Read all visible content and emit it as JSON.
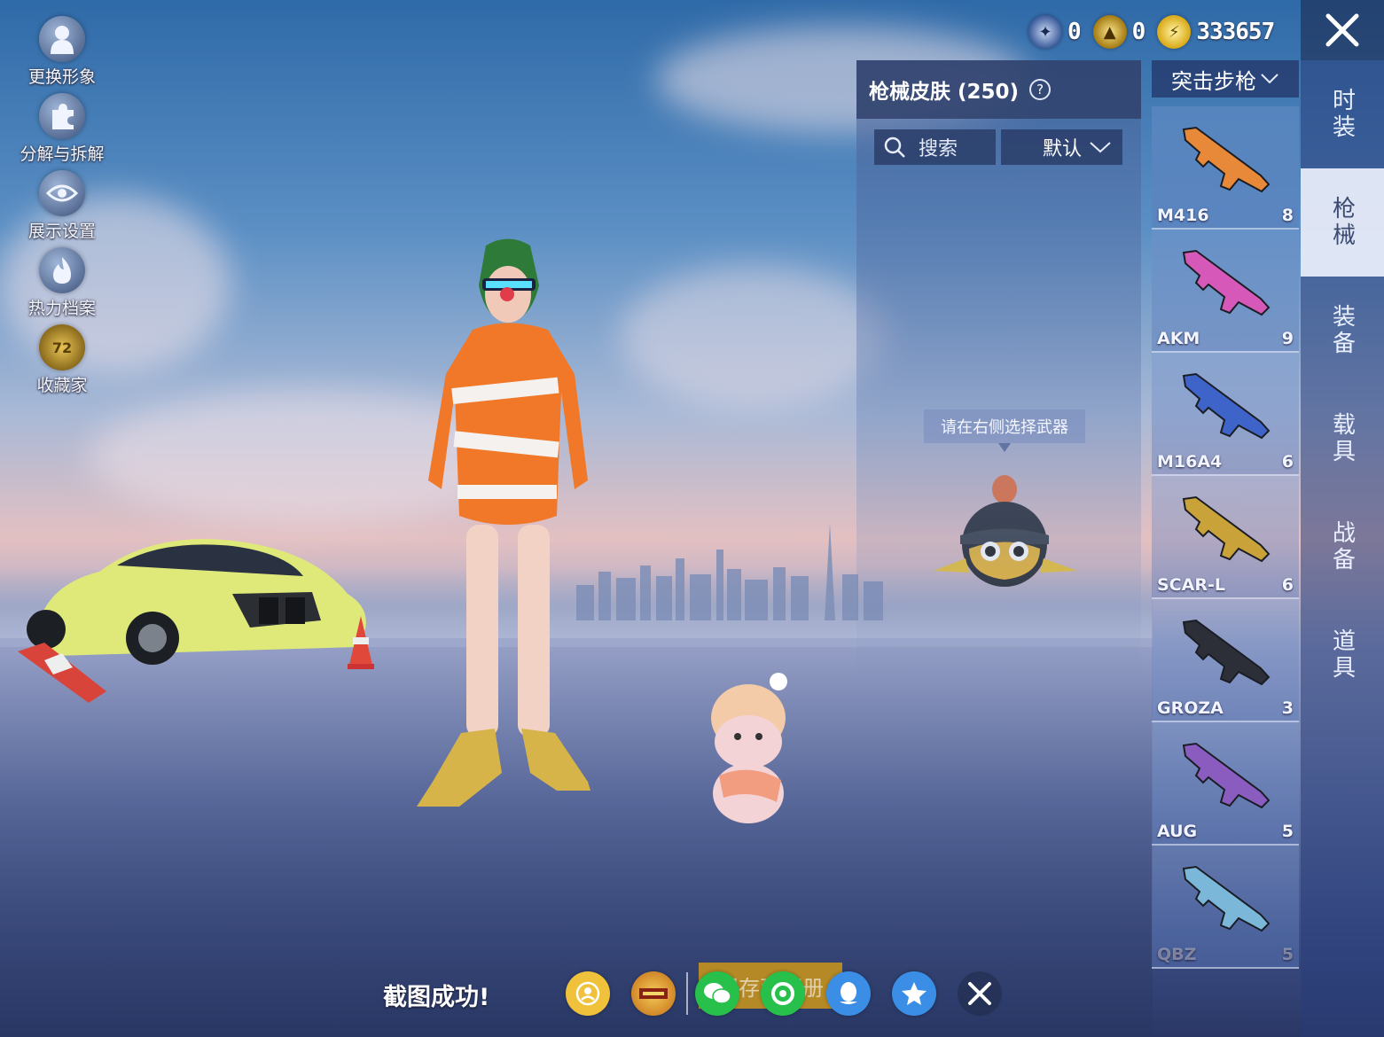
{
  "left_menu": [
    {
      "label": "更换形象",
      "icon": "person-icon"
    },
    {
      "label": "分解与拆解",
      "icon": "puzzle-icon"
    },
    {
      "label": "展示设置",
      "icon": "eye-icon"
    },
    {
      "label": "热力档案",
      "icon": "flame-icon"
    },
    {
      "label": "收藏家",
      "icon": "collector-badge-icon",
      "badge": "72"
    }
  ],
  "currency": [
    {
      "icon": "blue-coin-icon",
      "value": "0"
    },
    {
      "icon": "gold-coin-icon",
      "value": "0"
    },
    {
      "icon": "lightning-coin-icon",
      "value": "333657"
    }
  ],
  "skin_panel": {
    "title": "枪械皮肤 (250)",
    "help": "?",
    "search_placeholder": "搜索",
    "sort_label": "默认",
    "hint": "请在右侧选择武器"
  },
  "weapon_filter": {
    "label": "突击步枪"
  },
  "weapons": [
    {
      "name": "M416",
      "count": "8",
      "color": "#e8893a"
    },
    {
      "name": "AKM",
      "count": "9",
      "color": "#d659b9"
    },
    {
      "name": "M16A4",
      "count": "6",
      "color": "#3e63c9"
    },
    {
      "name": "SCAR-L",
      "count": "6",
      "color": "#c9a33a"
    },
    {
      "name": "GROZA",
      "count": "3",
      "color": "#2c2f38"
    },
    {
      "name": "AUG",
      "count": "5",
      "color": "#8a5cc0"
    },
    {
      "name": "QBZ",
      "count": "5",
      "color": "#7bb7d8"
    }
  ],
  "tabs": [
    {
      "label": "时装",
      "active": false
    },
    {
      "label": "枪械",
      "active": true
    },
    {
      "label": "装备",
      "active": false
    },
    {
      "label": "载具",
      "active": false
    },
    {
      "label": "战备",
      "active": false
    },
    {
      "label": "道具",
      "active": false
    }
  ],
  "bottom": {
    "screenshot_msg": "截图成功!",
    "save_label": "保存到相册",
    "shares": [
      "game-friend-icon",
      "game-for-peace-icon",
      "wechat-icon",
      "moments-icon",
      "qq-icon",
      "qzone-icon",
      "close-icon"
    ]
  },
  "colors": {
    "accent_gold": "#b58a26",
    "panel_blue": "#30426c",
    "wechat_green": "#27c04b",
    "qq_blue": "#3a8ee6"
  }
}
